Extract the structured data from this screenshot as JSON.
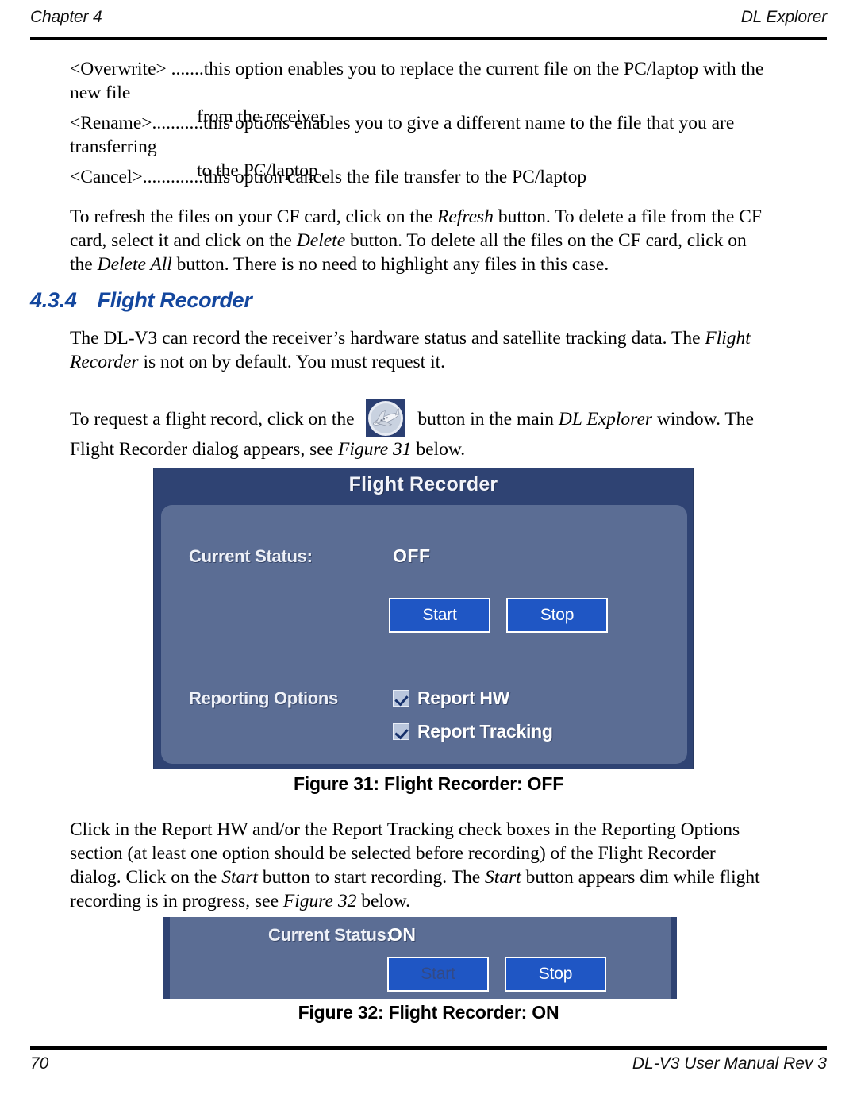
{
  "header": {
    "left": "Chapter 4",
    "right": "DL Explorer"
  },
  "footer": {
    "page_number": "70",
    "right": "DL-V3 User Manual Rev 3"
  },
  "definition_list": [
    {
      "term": "<Overwrite> .......",
      "description": "this option enables you to replace the current file on the PC/laptop with the new file",
      "continuation": "from the receiver"
    },
    {
      "term": "<Rename>...........",
      "description": "this options enables you to give a different name to the file that you are transferring",
      "continuation": "to the PC/laptop"
    },
    {
      "term": "<Cancel>.............",
      "description": "this option cancels the file transfer to the PC/laptop",
      "continuation": ""
    }
  ],
  "paragraphs": {
    "refresh_delete": {
      "part1": "To refresh the files on your CF card, click on the ",
      "em1": "Refresh",
      "part2": " button. To delete a file from the CF card, select it and click on the ",
      "em2": "Delete",
      "part3": " button. To delete all the files on the CF card, click on the ",
      "em3": "Delete All",
      "part4": " button. There is no need to highlight any files in this case."
    },
    "intro": {
      "part1": "The DL-V3 can record the receiver’s hardware status and satellite tracking data. The ",
      "em1": "Flight Recorder",
      "part2": " is not on by default. You must request it."
    },
    "request": {
      "part1": "To request a flight record, click on the ",
      "icon": "airplane-icon",
      "part2": " button in the main ",
      "em1": "DL Explorer",
      "part3": " window. The Flight Recorder dialog appears, see ",
      "em2": "Figure 31",
      "part4": " below."
    },
    "checkbox_instructions": {
      "part1": "Click in the Report HW and/or the Report Tracking check boxes in the Reporting Options section (at least one option should be selected before recording) of the Flight Recorder dialog. Click on the ",
      "em1": "Start",
      "part2": " button to start recording. The ",
      "em2": "Start",
      "part3": " button appears dim while flight recording is in progress, see ",
      "em3": "Figure 32",
      "part4": " below."
    }
  },
  "section": {
    "number": "4.3.4",
    "title": "Flight Recorder"
  },
  "figure31": {
    "caption": "Figure 31: Flight Recorder: OFF",
    "dialog": {
      "title": "Flight Recorder",
      "status_label": "Current Status:",
      "status_value": "OFF",
      "start_button": "Start",
      "stop_button": "Stop",
      "options_label": "Reporting Options",
      "checkboxes": [
        {
          "label": "Report HW",
          "checked": true
        },
        {
          "label": "Report Tracking",
          "checked": true
        }
      ]
    }
  },
  "figure32": {
    "caption": "Figure 32: Flight Recorder: ON",
    "dialog": {
      "status_label": "Current Status:",
      "status_value": "ON",
      "start_button": "Start",
      "stop_button": "Stop"
    }
  },
  "colors": {
    "heading_blue": "#14479e",
    "dialog_frame": "#2f4373",
    "dialog_panel": "#5b6d94",
    "button_blue": "#1f56c4",
    "button_border": "#ffffff",
    "dim_text": "#334a86"
  }
}
